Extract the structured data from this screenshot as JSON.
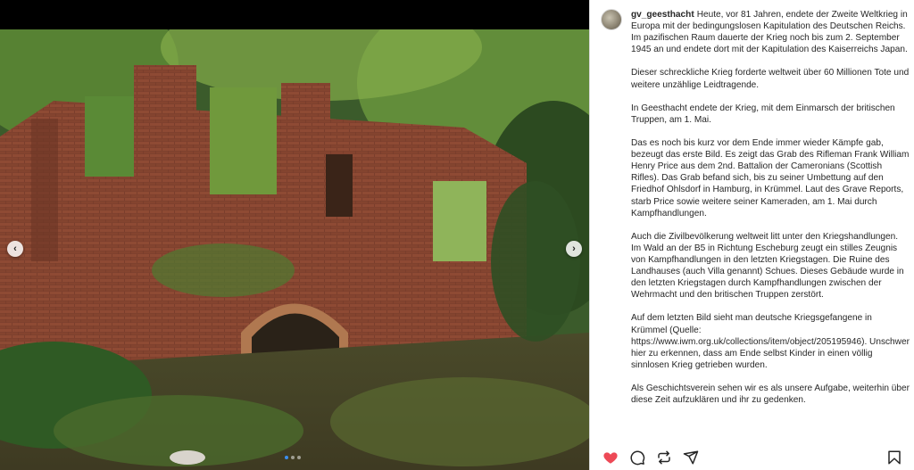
{
  "post": {
    "username": "gv_geesthacht",
    "caption_paragraphs": [
      "Heute, vor 81 Jahren, endete der Zweite Weltkrieg in Europa mit der bedingungslosen Kapitulation des Deutschen Reichs.",
      "Im pazifischen Raum dauerte der Krieg noch bis zum 2. September 1945 an und endete dort mit der Kapitulation des Kaiserreichs Japan.",
      "Dieser schreckliche Krieg forderte weltweit über 60 Millionen Tote und weitere unzählige Leidtragende.",
      "In Geesthacht endete der Krieg, mit dem Einmarsch der britischen Truppen, am 1. Mai.",
      "Das es noch bis kurz vor dem Ende immer wieder Kämpfe gab, bezeugt das erste Bild. Es zeigt das Grab des Rifleman Frank William Henry Price aus dem 2nd. Battalion der Cameronians (Scottish Rifles). Das Grab befand sich, bis zu seiner Umbettung auf den Friedhof Ohlsdorf in Hamburg, in Krümmel. Laut des Grave Reports, starb Price sowie weitere seiner Kameraden, am 1. Mai durch Kampfhandlungen.",
      "Auch die Zivilbevölkerung weltweit litt unter den Kriegshandlungen. Im Wald an der B5 in Richtung Escheburg zeugt ein stilles Zeugnis von Kampfhandlungen in den letzten Kriegstagen. Die Ruine des Landhauses (auch Villa genannt) Schues. Dieses Gebäude wurde in den letzten Kriegstagen durch Kampfhandlungen zwischen der Wehrmacht und den britischen Truppen zerstört.",
      "Auf dem letzten Bild sieht man deutsche Kriegsgefangene in Krümmel (Quelle: https://www.iwm.org.uk/collections/item/object/205195946). Unschwer hier zu erkennen, dass am Ende selbst Kinder in einen völlig sinnlosen Krieg getrieben wurden.",
      "Als Geschichtsverein sehen wir es als unsere Aufgabe, weiterhin über diese Zeit aufzuklären und ihr zu gedenken."
    ]
  },
  "carousel": {
    "prev_icon": "chevron-left-icon",
    "next_icon": "chevron-right-icon",
    "prev_glyph": "‹",
    "next_glyph": "›",
    "slide_count": 3,
    "active_index": 1
  },
  "actions": {
    "like_icon": "heart-icon",
    "comment_icon": "comment-icon",
    "repost_icon": "repost-icon",
    "share_icon": "share-icon",
    "save_icon": "bookmark-icon",
    "liked": true
  },
  "colors": {
    "like": "#ed4956",
    "dot_active": "#3a8ef0",
    "text": "#262626"
  }
}
